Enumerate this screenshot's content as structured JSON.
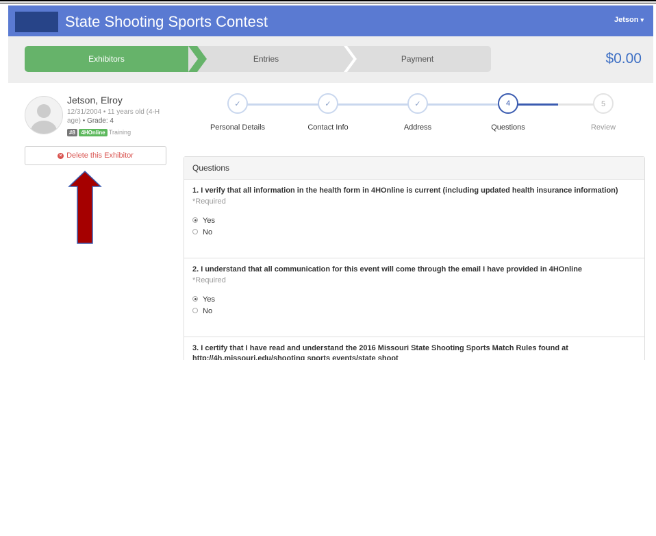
{
  "app": {
    "title": "State Shooting Sports Contest",
    "user": "Jetson",
    "user_caret": "▾"
  },
  "wizard": {
    "steps": [
      {
        "label": "Exhibitors",
        "active": true
      },
      {
        "label": "Entries"
      },
      {
        "label": "Payment"
      }
    ],
    "total": "$0.00"
  },
  "exhibitor": {
    "name": "Jetson, Elroy",
    "dob_age": "12/31/2004 • 11 years old (4-H age)",
    "grade": " • Grade: 4",
    "badge_id": "#8",
    "badge_source": "4HOnline",
    "badge_training": "Training",
    "delete_label": "Delete this Exhibitor",
    "delete_icon": "×"
  },
  "progress": {
    "steps": [
      {
        "label": "Personal Details",
        "marker": "✓",
        "state": "done"
      },
      {
        "label": "Contact Info",
        "marker": "✓",
        "state": "done"
      },
      {
        "label": "Address",
        "marker": "✓",
        "state": "done"
      },
      {
        "label": "Questions",
        "marker": "4",
        "state": "active"
      },
      {
        "label": "Review",
        "marker": "5",
        "state": "future"
      }
    ]
  },
  "questions": {
    "heading": "Questions",
    "items": [
      {
        "text": "1. I verify that all information in the health form in 4HOnline is current (including updated health insurance information)",
        "required": "*Required",
        "options": [
          "Yes",
          "No"
        ],
        "selected": "Yes"
      },
      {
        "text": "2. I understand that all communication for this event will come through the email I have provided in 4HOnline",
        "required": "*Required",
        "options": [
          "Yes",
          "No"
        ],
        "selected": "Yes"
      },
      {
        "text": "3. I certify that I have read and understand the 2016 Missouri State Shooting Sports Match Rules found at http://4h.missouri.edu/shooting sports events/state shoot"
      }
    ]
  },
  "colors": {
    "navbar": "#5a7ad2",
    "logo_block": "#274488",
    "exhibitors_step": "#66b36a",
    "total": "#3d6fc4",
    "delete": "#d9534f",
    "arrow": "#a50000",
    "arrow_outline": "#3a5bb0",
    "active_step": "#3a5bb0"
  }
}
